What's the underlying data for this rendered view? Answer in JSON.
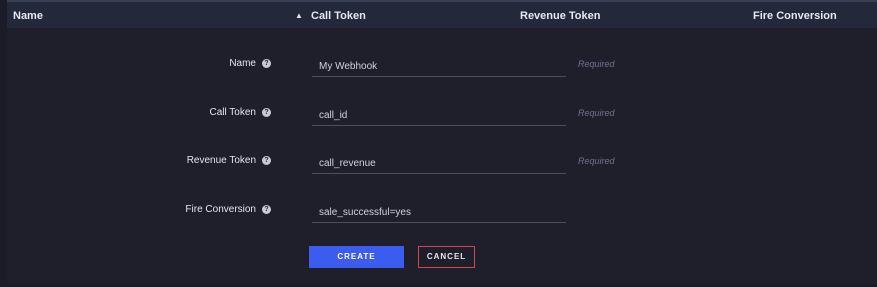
{
  "table_header": {
    "columns": [
      {
        "label": "Name"
      },
      {
        "label": "Call Token",
        "sorted": "ascending"
      },
      {
        "label": "Revenue Token"
      },
      {
        "label": "Fire Conversion"
      }
    ],
    "sort_icon": "▲"
  },
  "form": {
    "fields": [
      {
        "label": "Name",
        "value": "My Webhook",
        "hint": "Required"
      },
      {
        "label": "Call Token",
        "value": "call_id",
        "hint": "Required"
      },
      {
        "label": "Revenue Token",
        "value": "call_revenue",
        "hint": "Required"
      },
      {
        "label": "Fire Conversion",
        "value": "sale_successful=yes",
        "hint": ""
      }
    ],
    "help_icon": "?",
    "create_label": "CREATE",
    "cancel_label": "CANCEL"
  },
  "colors": {
    "background": "#1b1c27",
    "header": "#24283b",
    "primary_button": "#3c5cf0",
    "cancel_border": "#c84b4b"
  }
}
